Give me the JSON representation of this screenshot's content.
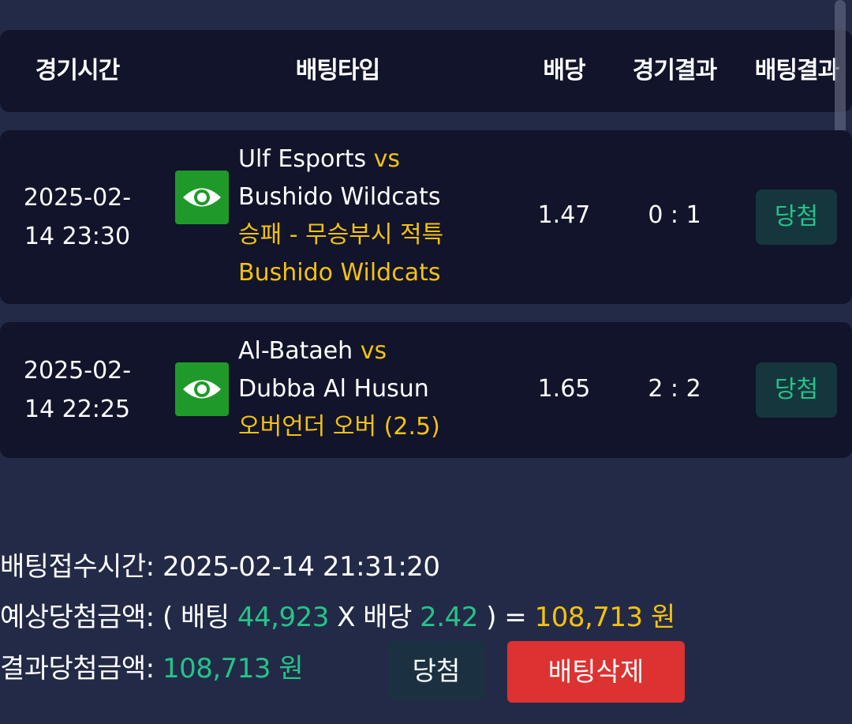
{
  "header": {
    "time": "경기시간",
    "bet_type": "배팅타입",
    "odds": "배당",
    "match_result": "경기결과",
    "bet_result": "배팅결과"
  },
  "rows": [
    {
      "date": "2025-02-",
      "time": "14 23:30",
      "home": "Ulf Esports",
      "vs": "vs",
      "away": "Bushido Wildcats",
      "market": "승패 - 무승부시 적특",
      "pick": "Bushido Wildcats",
      "odds": "1.47",
      "score": "0 : 1",
      "result": "당첨",
      "icon": "eye-icon"
    },
    {
      "date": "2025-02-",
      "time": "14 22:25",
      "home": "Al-Bataeh",
      "vs": "vs",
      "away": "Dubba Al Husun",
      "market": "오버언더 오버 (2.5)",
      "odds": "1.65",
      "score": "2 : 2",
      "result": "당첨",
      "icon": "eye-icon"
    }
  ],
  "summary": {
    "received_label": "배팅접수시간:",
    "received_value": "2025-02-14 21:31:20",
    "expected_label": "예상당첨금액:",
    "expected_open": "( 배팅",
    "bet_amount": "44,923",
    "times": "X 배당",
    "total_odds": "2.42",
    "expected_close": ") =",
    "expected_amount": "108,713 원",
    "result_label": "결과당첨금액:",
    "result_amount": "108,713 원"
  },
  "buttons": {
    "win": "당첨",
    "delete": "배팅삭제"
  },
  "colors": {
    "background": "#232a47",
    "panel": "#11142a",
    "accent_yellow": "#f4c20d",
    "accent_green": "#23c489",
    "eye_button": "#1f9a2a",
    "delete_button": "#dd3232"
  }
}
